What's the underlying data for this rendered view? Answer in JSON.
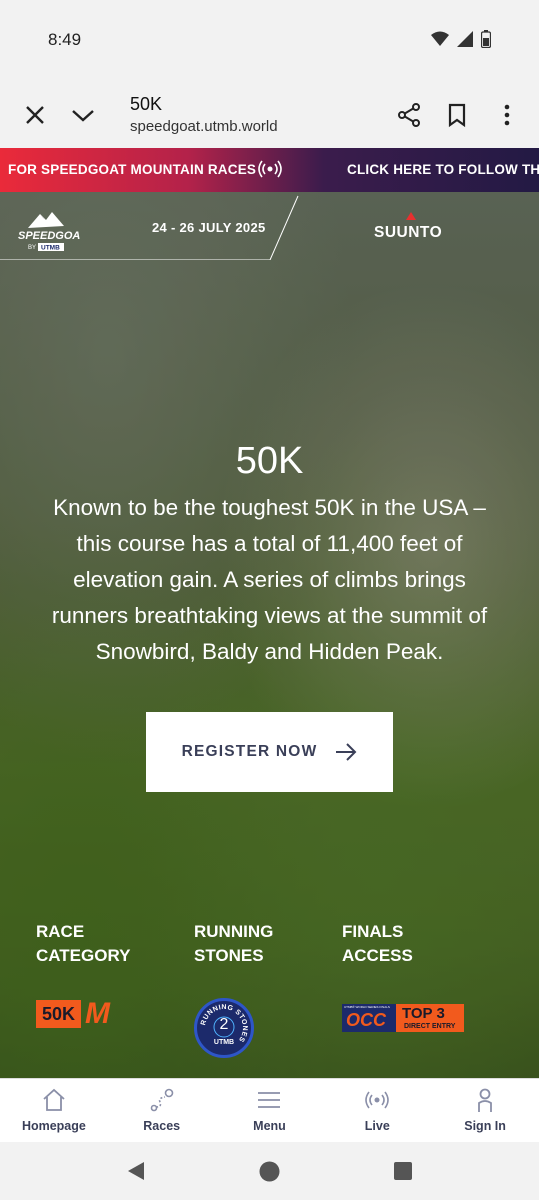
{
  "status_bar": {
    "time": "8:49",
    "icons": [
      "wifi-icon",
      "signal-icon",
      "battery-icon"
    ]
  },
  "browser": {
    "title": "50K",
    "url": "speedgoat.utmb.world",
    "icons": [
      "close-icon",
      "chevron-down-icon",
      "share-icon",
      "bookmark-icon",
      "more-vert-icon"
    ]
  },
  "ticker": {
    "item1": "FOR SPEEDGOAT MOUNTAIN RACES",
    "item2": "CLICK HERE TO FOLLOW THE",
    "live_icon": "live-broadcast-icon",
    "colors": {
      "start": "#ea2a3a",
      "end": "#231a44"
    }
  },
  "header": {
    "logo_text": "SPEEDGOAT",
    "logo_sub": "BY",
    "logo_brand": "UTMB",
    "dates": "24 - 26 JULY 2025",
    "sponsor": "SUUNTO"
  },
  "hero": {
    "title": "50K",
    "description": "Known to be the toughest 50K in the USA – this course has a total of 11,400 feet of elevation gain. A series of climbs brings runners breathtaking views at the summit of Snowbird, Baldy and Hidden Peak.",
    "register_label": "REGISTER NOW"
  },
  "stats": {
    "race_category": {
      "label_line1": "RACE",
      "label_line2": "CATEGORY",
      "badge": "50K",
      "badge_suffix": "M"
    },
    "running_stones": {
      "label_line1": "RUNNING",
      "label_line2": "STONES",
      "badge_ring": "RUNNING STONES",
      "badge_value": "2",
      "badge_brand": "UTMB"
    },
    "finals_access": {
      "label_line1": "FINALS",
      "label_line2": "ACCESS",
      "badge_left": "OCC",
      "badge_small": "UTMB® WORLD SERIES FINALS",
      "badge_right": "TOP 3",
      "badge_right_sub": "DIRECT ENTRY"
    },
    "accent": "#f25a1d",
    "navy": "#1c2a6b"
  },
  "bottom_nav": {
    "items": [
      {
        "label": "Homepage",
        "icon": "home-icon"
      },
      {
        "label": "Races",
        "icon": "route-icon"
      },
      {
        "label": "Menu",
        "icon": "menu-icon"
      },
      {
        "label": "Live",
        "icon": "live-icon"
      },
      {
        "label": "Sign In",
        "icon": "user-icon"
      }
    ]
  },
  "system_nav": {
    "icons": [
      "back-icon",
      "home-circle-icon",
      "recents-icon"
    ]
  }
}
